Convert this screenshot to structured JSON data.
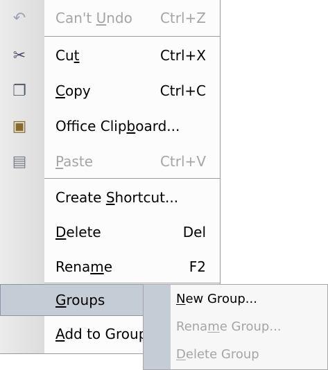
{
  "menu": {
    "items": [
      {
        "name": "cant-undo",
        "icon": "undo-icon",
        "glyph": "↶",
        "pre": "Can't ",
        "key": "U",
        "post": "ndo",
        "shortcut": "Ctrl+Z",
        "disabled": true
      },
      {
        "name": "cut",
        "icon": "scissors-icon",
        "glyph": "✂",
        "pre": "Cu",
        "key": "t",
        "post": "",
        "shortcut": "Ctrl+X",
        "disabled": false
      },
      {
        "name": "copy",
        "icon": "copy-icon",
        "glyph": "❐",
        "pre": "",
        "key": "C",
        "post": "opy",
        "shortcut": "Ctrl+C",
        "disabled": false
      },
      {
        "name": "office-clipboard",
        "icon": "clipboard-icon",
        "glyph": "▣",
        "pre": "Office Clip",
        "key": "b",
        "post": "oard...",
        "shortcut": "",
        "disabled": false
      },
      {
        "name": "paste",
        "icon": "paste-icon",
        "glyph": "▤",
        "pre": "",
        "key": "P",
        "post": "aste",
        "shortcut": "Ctrl+V",
        "disabled": true
      },
      {
        "name": "create-shortcut",
        "icon": "",
        "glyph": "",
        "pre": "Create ",
        "key": "S",
        "post": "hortcut...",
        "shortcut": "",
        "disabled": false
      },
      {
        "name": "delete",
        "icon": "",
        "glyph": "",
        "pre": "",
        "key": "D",
        "post": "elete",
        "shortcut": "Del",
        "disabled": false
      },
      {
        "name": "rename",
        "icon": "",
        "glyph": "",
        "pre": "Rena",
        "key": "m",
        "post": "e",
        "shortcut": "F2",
        "disabled": false
      },
      {
        "name": "groups",
        "icon": "",
        "glyph": "",
        "pre": "",
        "key": "G",
        "post": "roups",
        "shortcut": "",
        "disabled": false,
        "highlighted": true,
        "submenu": true
      },
      {
        "name": "add-to-group",
        "icon": "",
        "glyph": "",
        "pre": "",
        "key": "A",
        "post": "dd to Group",
        "shortcut": "",
        "disabled": false
      }
    ]
  },
  "submenu": {
    "items": [
      {
        "name": "new-group",
        "pre": "",
        "key": "N",
        "post": "ew Group...",
        "disabled": false
      },
      {
        "name": "rename-group",
        "pre": "Rena",
        "key": "m",
        "post": "e Group...",
        "disabled": true
      },
      {
        "name": "delete-group",
        "pre": "",
        "key": "D",
        "post": "elete Group",
        "disabled": true
      }
    ]
  },
  "colors": {
    "highlight": "#c4ccd6",
    "disabled_text": "#a5a5a5",
    "separator": "#9d9d9d"
  }
}
